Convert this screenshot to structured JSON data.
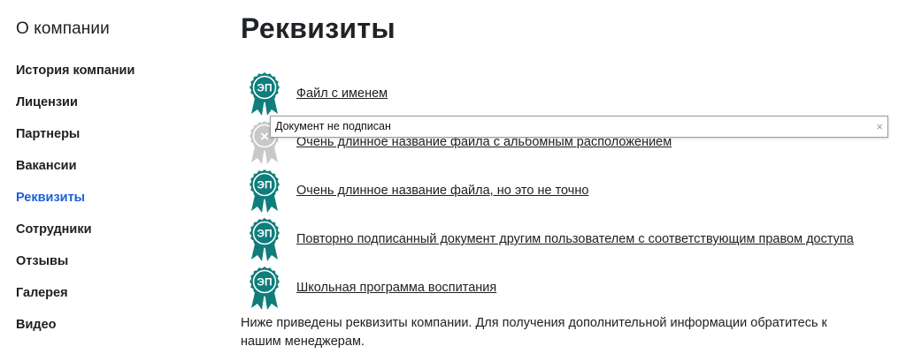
{
  "sidebar": {
    "title": "О компании",
    "items": [
      {
        "label": "История компании",
        "active": false
      },
      {
        "label": "Лицензии",
        "active": false
      },
      {
        "label": "Партнеры",
        "active": false
      },
      {
        "label": "Вакансии",
        "active": false
      },
      {
        "label": "Реквизиты",
        "active": true
      },
      {
        "label": "Сотрудники",
        "active": false
      },
      {
        "label": "Отзывы",
        "active": false
      },
      {
        "label": "Галерея",
        "active": false
      },
      {
        "label": "Видео",
        "active": false
      }
    ]
  },
  "main": {
    "title": "Реквизиты",
    "files": [
      {
        "name": "Файл с именем",
        "signed": true,
        "badge": "ЭП"
      },
      {
        "name": "Очень длинное название файла с альбомным расположением",
        "signed": false,
        "badge": "×"
      },
      {
        "name": "Очень длинное название файла, но это не точно",
        "signed": true,
        "badge": "ЭП"
      },
      {
        "name": "Повторно подписанный документ другим пользователем с соответствующим правом доступа",
        "signed": true,
        "badge": "ЭП"
      },
      {
        "name": "Школьная программа воспитания",
        "signed": true,
        "badge": "ЭП"
      }
    ],
    "tooltip": {
      "text": "Документ не подписан",
      "close": "×"
    },
    "description": "Ниже приведены реквизиты компании. Для получения дополнительной информации обратитесь к нашим менеджерам."
  },
  "colors": {
    "active_link": "#1d5fd6",
    "signed_badge": "#0f7d7b",
    "unsigned_badge": "#c8c8c8"
  }
}
